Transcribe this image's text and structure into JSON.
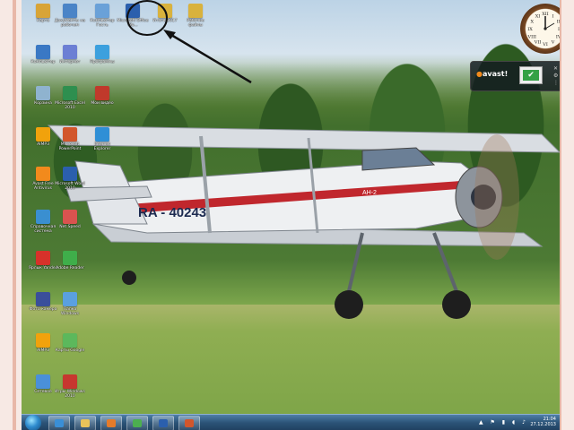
{
  "desktop": {
    "icons": [
      {
        "label": "Карта",
        "icon": "folder-icon",
        "color": "#d8a437"
      },
      {
        "label": "Документы на рабочем",
        "icon": "documents-icon",
        "color": "#4a84c7"
      },
      {
        "label": "Компьютер Гость",
        "icon": "computer-icon",
        "color": "#6aa1d8"
      },
      {
        "label": "Microsoft Office Wo...",
        "icon": "word-icon",
        "color": "#2b5fad"
      },
      {
        "label": "Итоги 2017",
        "icon": "folder-icon",
        "color": "#d9b23d"
      },
      {
        "label": "Рабочие файлы",
        "icon": "folder-icon",
        "color": "#d9b23d"
      },
      {
        "label": "Компьютер",
        "icon": "computer-icon",
        "color": "#3a78c4"
      },
      {
        "label": "Интернет",
        "icon": "network-icon",
        "color": "#6c7fd4"
      },
      {
        "label": "Программы",
        "icon": "programs-icon",
        "color": "#3ca0de"
      },
      {
        "label": "Корзина",
        "icon": "recycle-bin-icon",
        "color": "#8fb3cf"
      },
      {
        "label": "Microsoft Excel 2010",
        "icon": "excel-icon",
        "color": "#2e8f4f"
      },
      {
        "label": "Мои видео",
        "icon": "video-icon",
        "color": "#c0392b"
      },
      {
        "label": "AIMP3",
        "icon": "aimp-icon",
        "color": "#f1a20c"
      },
      {
        "label": "Microsoft PowerPoint",
        "icon": "powerpoint-icon",
        "color": "#d2562c"
      },
      {
        "label": "Internet Explorer",
        "icon": "ie-icon",
        "color": "#2f8fd6"
      },
      {
        "label": "Avast Free Antivirus",
        "icon": "avast-icon",
        "color": "#f28a1c"
      },
      {
        "label": "Microsoft Word 2010",
        "icon": "word-icon",
        "color": "#2b5fad"
      },
      {
        "label": "Справочная система",
        "icon": "help-icon",
        "color": "#3a8fd0"
      },
      {
        "label": "Net Speed",
        "icon": "netspeed-icon",
        "color": "#d9534f"
      },
      {
        "label": "Ярлык Yandex",
        "icon": "yandex-icon",
        "color": "#d7312a"
      },
      {
        "label": "Adobe Reader",
        "icon": "reader-icon",
        "color": "#3fae4a"
      },
      {
        "label": "Фото камера",
        "icon": "camera-icon",
        "color": "#3a4f9b"
      },
      {
        "label": "Папка Windows",
        "icon": "network-folder-icon",
        "color": "#5aa0e0"
      },
      {
        "label": "AIMP3",
        "icon": "aimp-icon",
        "color": "#f1a20c"
      },
      {
        "label": "Карты Google",
        "icon": "maps-icon",
        "color": "#5cb85c"
      },
      {
        "label": "Сетевое",
        "icon": "network-icon",
        "color": "#4a90d9"
      },
      {
        "label": "Игры Windows 2010",
        "icon": "games-icon",
        "color": "#c7372f"
      }
    ]
  },
  "aircraft": {
    "registration": "RA - 40243",
    "model": "АН-2"
  },
  "gadgets": {
    "clock": {
      "numerals": [
        "XII",
        "I",
        "II",
        "III",
        "IV",
        "V",
        "VI",
        "VII",
        "VIII",
        "IX",
        "X",
        "XI"
      ]
    },
    "avast": {
      "brand": "avast!"
    }
  },
  "taskbar": {
    "time": "21:04",
    "date": "27.12.2013",
    "buttons": [
      {
        "icon": "ie-icon",
        "color": "#3a8fd6"
      },
      {
        "icon": "explorer-folder-icon",
        "color": "#e8c35a"
      },
      {
        "icon": "media-player-icon",
        "color": "#e57b2a"
      },
      {
        "icon": "chrome-icon",
        "color": "#4caf50"
      },
      {
        "icon": "word-doc-icon",
        "color": "#2b5fad"
      },
      {
        "icon": "presentation-icon",
        "color": "#d2562c"
      }
    ]
  },
  "colors": {
    "border": "#f7e9e4",
    "accent_stripe": "#e8b8a8",
    "taskbar": "#2b5377"
  }
}
